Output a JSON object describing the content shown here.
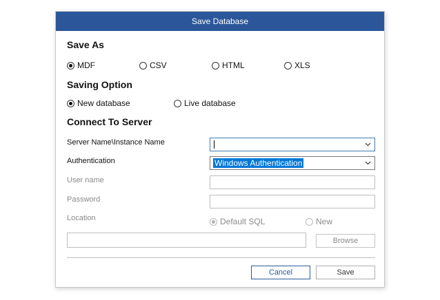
{
  "dialog": {
    "title": "Save Database"
  },
  "save_as": {
    "heading": "Save As",
    "options": [
      {
        "label": "MDF",
        "checked": true
      },
      {
        "label": "CSV",
        "checked": false
      },
      {
        "label": "HTML",
        "checked": false
      },
      {
        "label": "XLS",
        "checked": false
      }
    ]
  },
  "saving_option": {
    "heading": "Saving Option",
    "options": [
      {
        "label": "New database",
        "checked": true
      },
      {
        "label": "Live database",
        "checked": false
      }
    ]
  },
  "connect": {
    "heading": "Connect To Server",
    "server_label": "Server Name\\Instance Name",
    "server_value": "",
    "auth_label": "Authentication",
    "auth_value": "Windows Authentication",
    "username_label": "User name",
    "password_label": "Password",
    "location_label": "Location",
    "location_options": [
      {
        "label": "Default SQL",
        "checked": true
      },
      {
        "label": "New",
        "checked": false
      }
    ],
    "browse_label": "Browse"
  },
  "footer": {
    "cancel_label": "Cancel",
    "save_label": "Save"
  },
  "colors": {
    "titlebar": "#2b579a",
    "selection": "#0078d7"
  }
}
